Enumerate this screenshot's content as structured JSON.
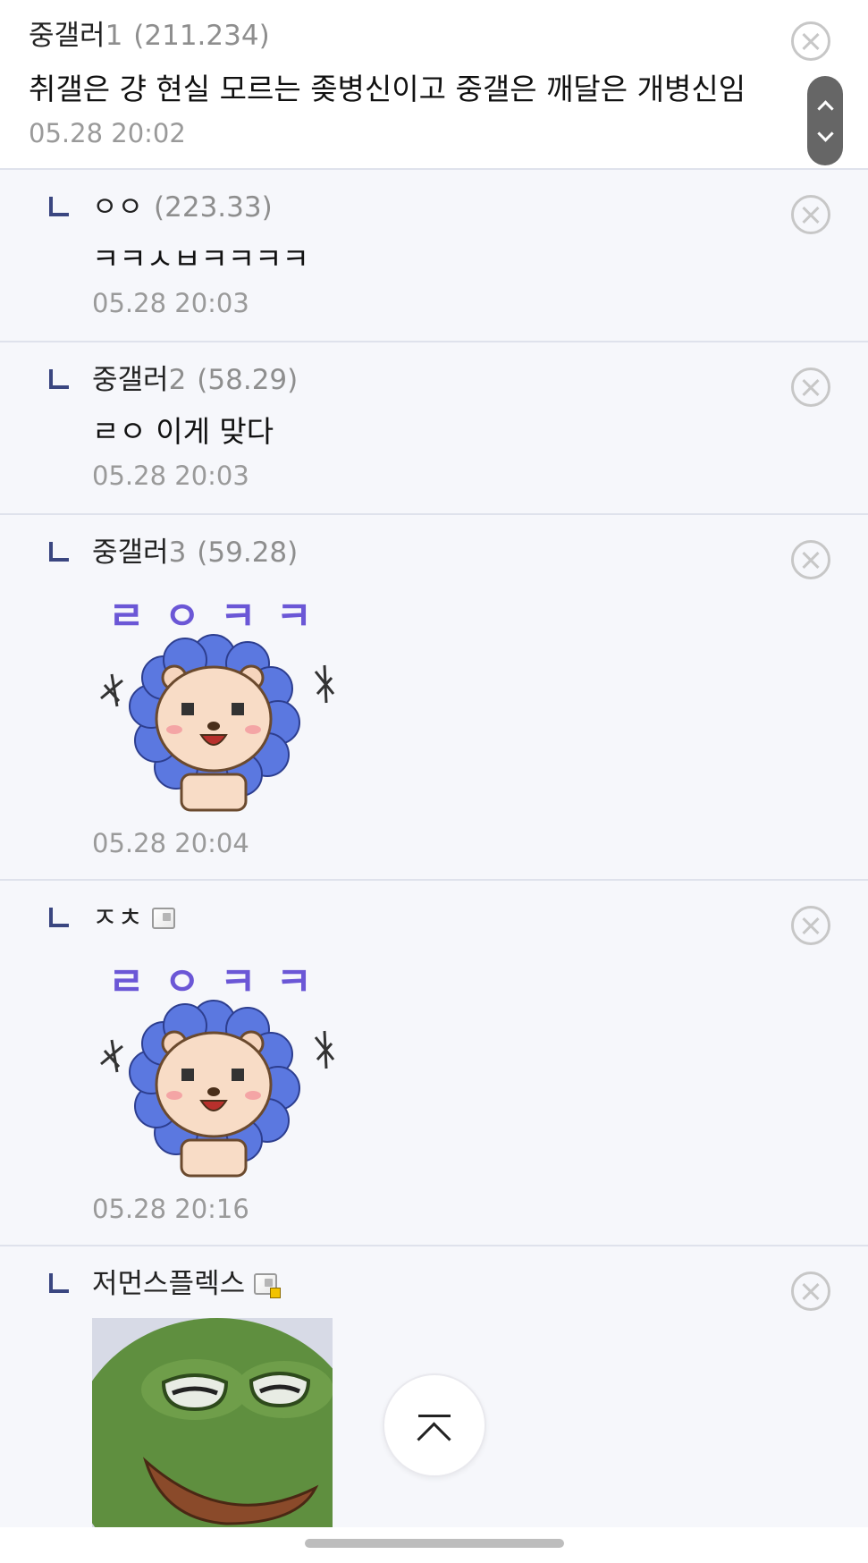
{
  "comments": [
    {
      "nick": "중갤러",
      "nick_suffix": "1",
      "ip": "(211.234)",
      "text": "취갤은 걍 현실 모르는 좆병신이고 중갤은 깨달은 개병신임",
      "time": "05.28 20:02"
    },
    {
      "nick": "ㅇㅇ",
      "ip": "(223.33)",
      "text": "ㅋㅋㅅㅂㅋㅋㅋㅋ",
      "time": "05.28 20:03"
    },
    {
      "nick": "중갤러",
      "nick_suffix": "2",
      "ip": "(58.29)",
      "text": "ㄹㅇ 이게 맞다",
      "time": "05.28 20:03"
    },
    {
      "nick": "중갤러",
      "nick_suffix": "3",
      "ip": "(59.28)",
      "sticker_text": "ㄹㅇㅋㅋ",
      "time": "05.28 20:04"
    },
    {
      "nick": "ㅈㅊ",
      "sticker_text": "ㄹㅇㅋㅋ",
      "time": "05.28 20:16"
    },
    {
      "nick": "저먼스플렉스"
    }
  ],
  "icons": {
    "reply": "reply-corner-icon",
    "delete": "close-circle-icon",
    "gallog": "gallog-icon",
    "scroll": "scroll-up-down-icon",
    "to_top": "scroll-to-top-icon"
  },
  "colors": {
    "reply_bg": "#f6f7fb",
    "reply_mark": "#3a4680",
    "meta_gray": "#8e8e8e",
    "sticker_petal": "#5b78e0",
    "sticker_text": "#6b57d6"
  }
}
